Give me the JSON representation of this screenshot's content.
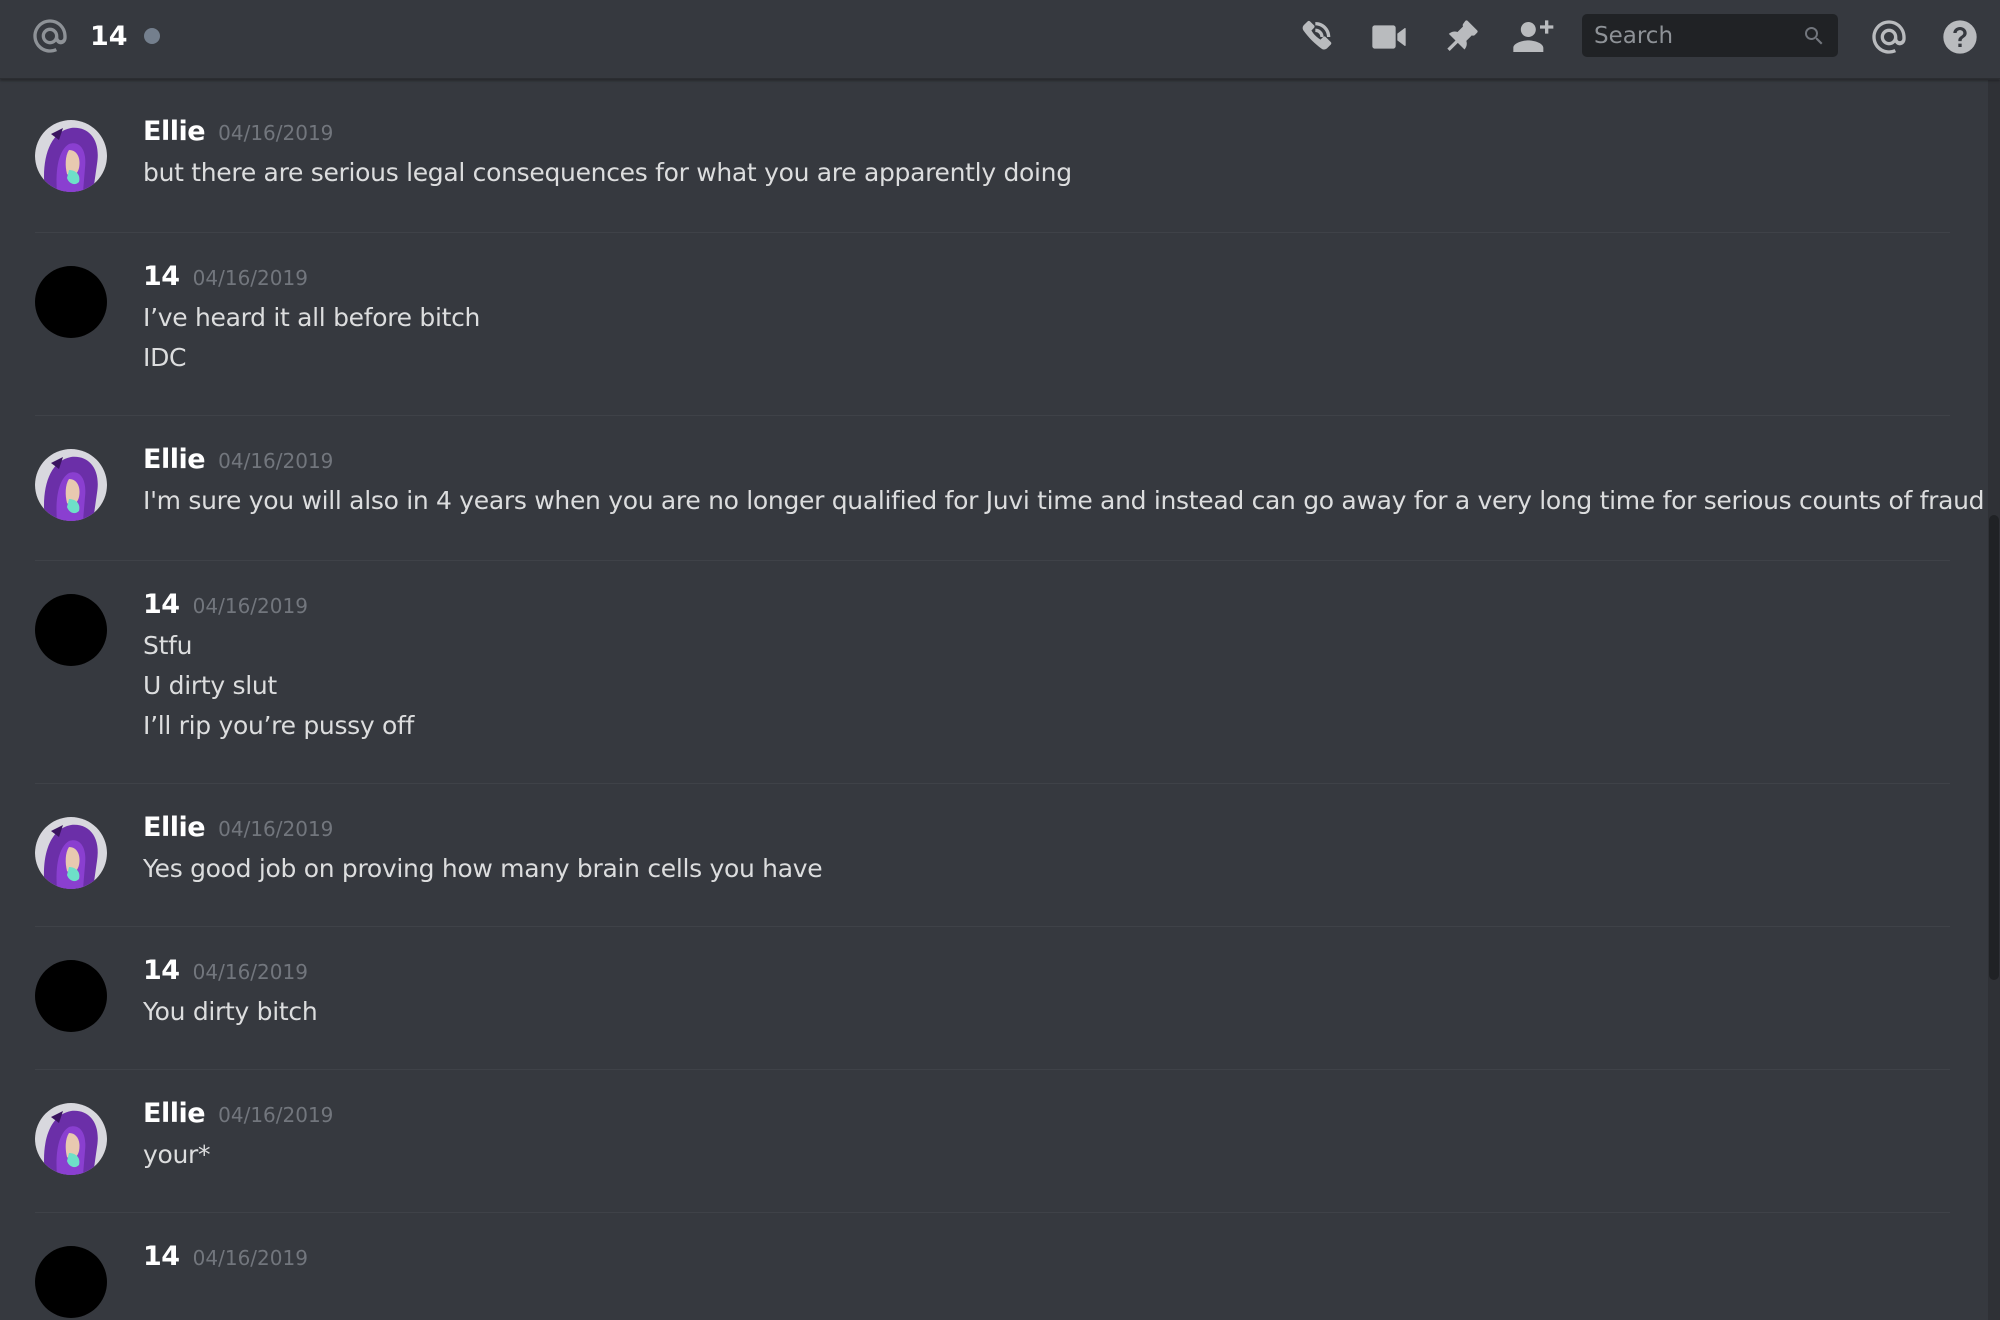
{
  "header": {
    "channel_name": "14",
    "search_placeholder": "Search",
    "icons": [
      "at-icon",
      "call-icon",
      "video-icon",
      "pin-icon",
      "add-friend-icon",
      "search-icon",
      "mentions-icon",
      "help-icon"
    ]
  },
  "messages": [
    {
      "author": "Ellie",
      "timestamp": "04/16/2019",
      "avatar": "ellie",
      "lines": [
        "but there are serious legal consequences for what you are apparently doing"
      ]
    },
    {
      "author": "14",
      "timestamp": "04/16/2019",
      "avatar": "black",
      "lines": [
        "I’ve heard it all before bitch",
        "IDC"
      ]
    },
    {
      "author": "Ellie",
      "timestamp": "04/16/2019",
      "avatar": "ellie",
      "lines": [
        "I'm sure you will also in 4 years when you are no longer qualified for Juvi time and instead can go away for a very long time for serious counts of fraud"
      ]
    },
    {
      "author": "14",
      "timestamp": "04/16/2019",
      "avatar": "black",
      "lines": [
        "Stfu",
        "U dirty slut",
        "I’ll rip you’re pussy off"
      ]
    },
    {
      "author": "Ellie",
      "timestamp": "04/16/2019",
      "avatar": "ellie",
      "lines": [
        "Yes good job on proving how many brain cells you have"
      ]
    },
    {
      "author": "14",
      "timestamp": "04/16/2019",
      "avatar": "black",
      "lines": [
        "You dirty bitch"
      ]
    },
    {
      "author": "Ellie",
      "timestamp": "04/16/2019",
      "avatar": "ellie",
      "lines": [
        "your*"
      ]
    },
    {
      "author": "14",
      "timestamp": "04/16/2019",
      "avatar": "black",
      "lines": []
    }
  ],
  "colors": {
    "background": "#36393f",
    "username": "#ffffff",
    "timestamp": "#72767d",
    "text": "#dcddde",
    "icon": "#b9bbbe",
    "status_dot": "#747f8d"
  }
}
